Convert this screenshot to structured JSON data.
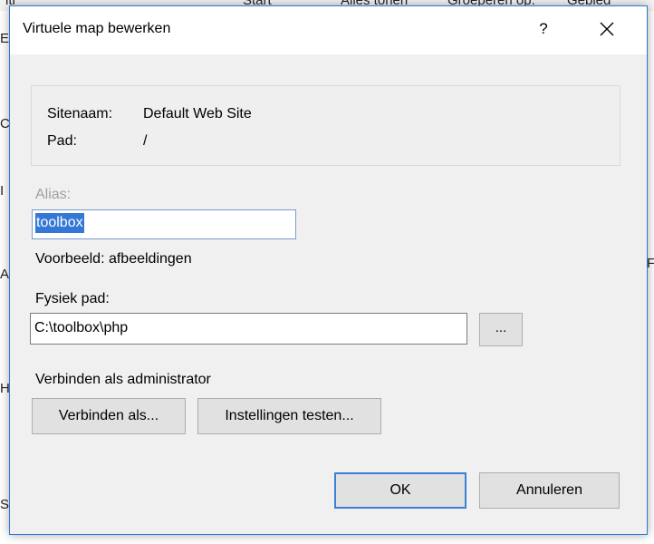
{
  "background": {
    "tabs": [
      "ltr",
      "Start",
      "Alles tonen",
      "Groeperen op:",
      "Gebied"
    ],
    "left_letters": [
      "E",
      "Co",
      "I",
      "A",
      "H",
      "S"
    ],
    "right_letter": "F"
  },
  "dialog": {
    "title": "Virtuele map bewerken",
    "help": "?",
    "info": {
      "site_label": "Sitenaam:",
      "site_value": "Default Web Site",
      "path_label": "Pad:",
      "path_value": "/"
    },
    "alias": {
      "label": "Alias:",
      "value": "toolbox",
      "example": "Voorbeeld: afbeeldingen"
    },
    "physical_path": {
      "label": "Fysiek pad:",
      "value": "C:\\toolbox\\php",
      "browse_label": "..."
    },
    "connect": {
      "label": "Verbinden als administrator",
      "connect_as_button": "Verbinden als...",
      "test_settings_button": "Instellingen testen..."
    },
    "ok_button": "OK",
    "cancel_button": "Annuleren"
  },
  "colors": {
    "accent": "#3c7fd6",
    "selection": "#3478d6",
    "dialog_bg": "#f0f0f0"
  }
}
